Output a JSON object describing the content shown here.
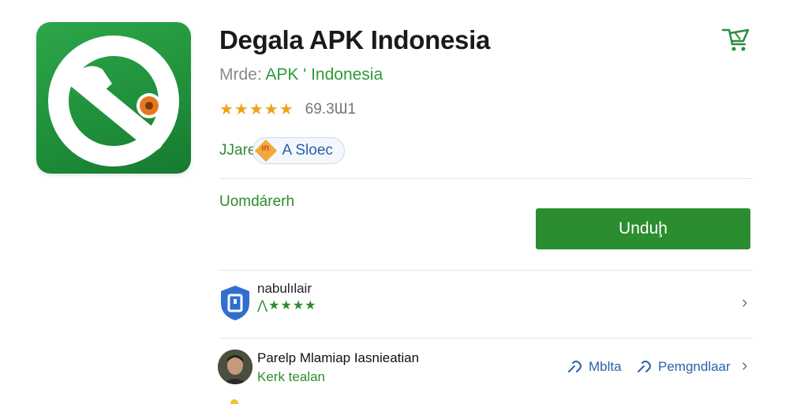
{
  "app": {
    "title": "Degala APK Indonesia",
    "mode_label": "Mrde:",
    "mode_value": "APK ' Indonesia",
    "stars": "★★★★★",
    "rating_count": "69.3Ɯ1",
    "tag_text": "JJare",
    "tag_pill_text": "A Sloec",
    "tag_badge_text": "ın"
  },
  "download": {
    "section_label": "Uomdárerh",
    "button_label": "Unduḩ"
  },
  "rows": {
    "first": {
      "name": "nabulılair",
      "stars": "⋀★★★★"
    },
    "second": {
      "name": "Parelp Mlamiap Iasnieatian",
      "subtitle": "Kerk tealan"
    }
  },
  "links": {
    "left": "Mblta",
    "right": "Pemgndlaar"
  },
  "icons": {
    "app_icon": "phone-logo-icon",
    "cart": "cart-icon",
    "shield": "shield-icon",
    "chevron": "chevron-right-icon",
    "link": "link-icon"
  },
  "colors": {
    "brand_green": "#2a8d2f",
    "star_orange": "#f0a11c",
    "link_blue": "#2a62a8"
  }
}
